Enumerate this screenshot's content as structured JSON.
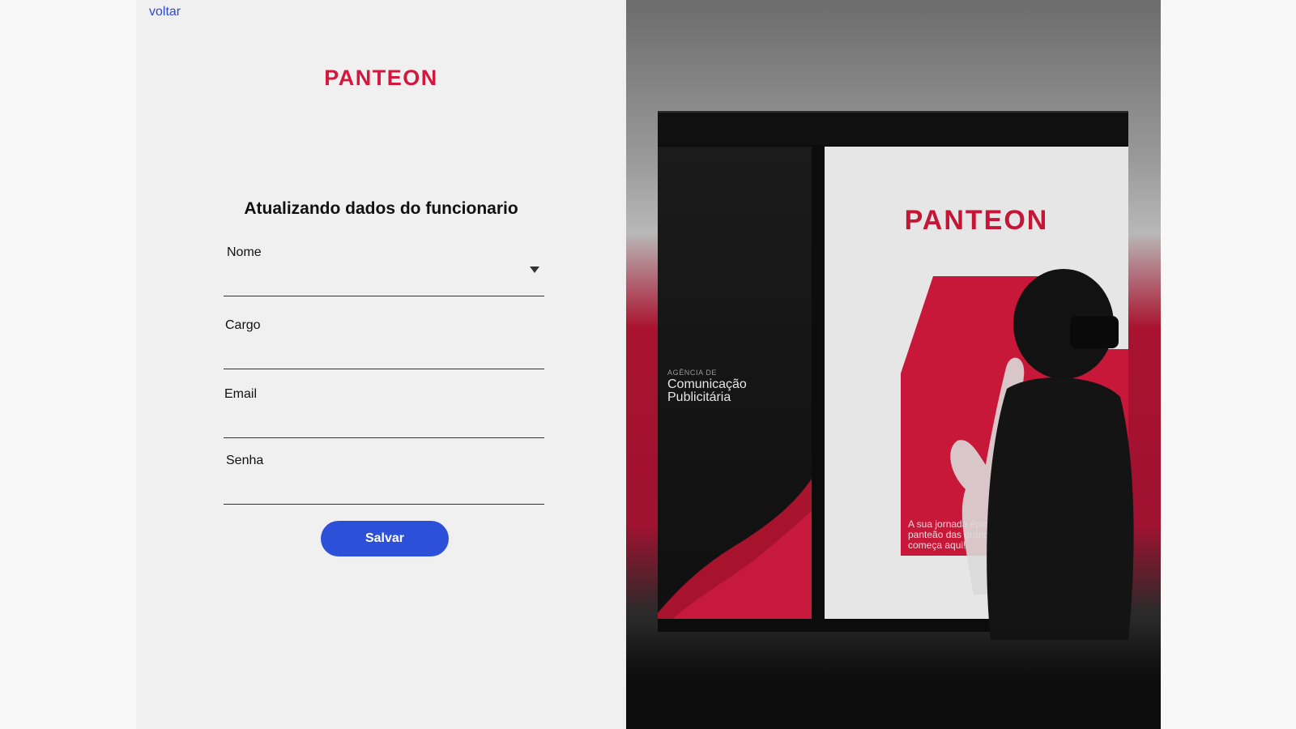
{
  "nav": {
    "back_label": "voltar"
  },
  "brand": {
    "logo_text": "PANTEON"
  },
  "form": {
    "title": "Atualizando dados do funcionario",
    "fields": [
      {
        "label": "Nome",
        "value": "",
        "type": "select"
      },
      {
        "label": "Cargo",
        "value": ""
      },
      {
        "label": "Email",
        "value": ""
      },
      {
        "label": "Senha",
        "value": ""
      }
    ],
    "submit_label": "Salvar"
  },
  "promo": {
    "brand": "PANTEON",
    "agency_small": "AGÊNCIA DE",
    "agency_title": "Comunicação Publicitária",
    "tagline": "A sua jornada épica n panteão das grandes começa aqui!"
  },
  "colors": {
    "brand_red": "#d3173d",
    "accent_blue": "#2c51d8",
    "link_blue": "#2f49c8",
    "panel_bg": "#f0f0f0"
  }
}
